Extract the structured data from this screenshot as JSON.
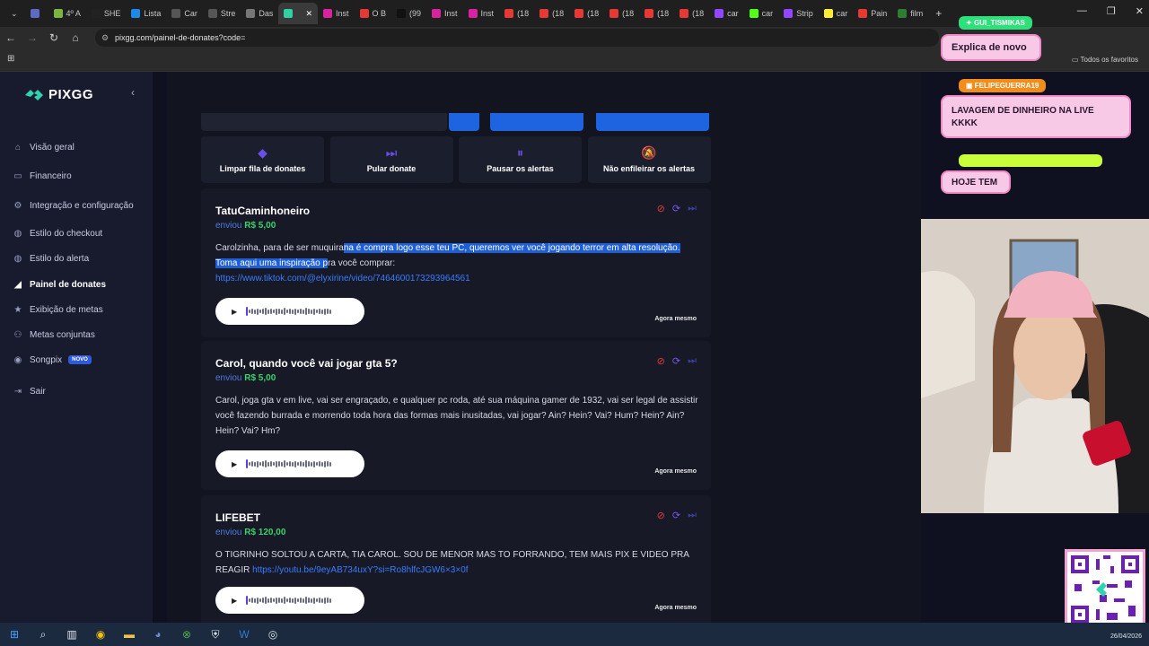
{
  "browser": {
    "tabs": [
      {
        "label": "",
        "color": "#5c6bc0"
      },
      {
        "label": "4º A",
        "color": "#7cb342"
      },
      {
        "label": "SHE",
        "color": "#222222"
      },
      {
        "label": "Lista",
        "color": "#1e88e5"
      },
      {
        "label": "Car",
        "color": "#555555"
      },
      {
        "label": "Stre",
        "color": "#555555"
      },
      {
        "label": "Das",
        "color": "#777777"
      },
      {
        "label": "",
        "color": "#30d0a0",
        "active": true
      },
      {
        "label": "Inst",
        "color": "#d6249f"
      },
      {
        "label": "O B",
        "color": "#e53935"
      },
      {
        "label": "(99",
        "color": "#111111"
      },
      {
        "label": "Inst",
        "color": "#d6249f"
      },
      {
        "label": "Inst",
        "color": "#d6249f"
      },
      {
        "label": "(18",
        "color": "#e53935"
      },
      {
        "label": "(18",
        "color": "#e53935"
      },
      {
        "label": "(18",
        "color": "#e53935"
      },
      {
        "label": "(18",
        "color": "#e53935"
      },
      {
        "label": "(18",
        "color": "#e53935"
      },
      {
        "label": "(18",
        "color": "#e53935"
      },
      {
        "label": "car",
        "color": "#9146ff"
      },
      {
        "label": "car",
        "color": "#53fc18"
      },
      {
        "label": "Strip",
        "color": "#9146ff"
      },
      {
        "label": "car",
        "color": "#ffeb3b"
      },
      {
        "label": "Pain",
        "color": "#e53935"
      },
      {
        "label": "film",
        "color": "#2e7d32"
      }
    ],
    "url": "pixgg.com/painel-de-donates?code=",
    "bookmarks_label": "Todos os favoritos"
  },
  "sidebar": {
    "logo": "PIXGG",
    "items": [
      {
        "label": "Visão geral",
        "icon": "home-icon",
        "glyph": "⌂"
      },
      {
        "label": "Financeiro",
        "icon": "wallet-icon",
        "glyph": "▭"
      },
      {
        "label": "Integração e configuração",
        "icon": "plug-icon",
        "glyph": "⚙"
      },
      {
        "label": "Estilo do checkout",
        "icon": "palette-icon",
        "glyph": "◍"
      },
      {
        "label": "Estilo do alerta",
        "icon": "palette-icon",
        "glyph": "◍"
      },
      {
        "label": "Painel de donates",
        "icon": "dashboard-icon",
        "glyph": "◢",
        "active": true
      },
      {
        "label": "Exibição de metas",
        "icon": "star-icon",
        "glyph": "★"
      },
      {
        "label": "Metas conjuntas",
        "icon": "users-icon",
        "glyph": "⚇"
      },
      {
        "label": "Songpix",
        "icon": "music-icon",
        "glyph": "◉",
        "badge": "NOVO"
      },
      {
        "label": "Sair",
        "icon": "logout-icon",
        "glyph": "⇥"
      }
    ]
  },
  "actions": [
    {
      "label": "Limpar fila de donates",
      "icon": "eraser-icon",
      "glyph": "◆"
    },
    {
      "label": "Pular donate",
      "icon": "skip-icon",
      "glyph": "⏭"
    },
    {
      "label": "Pausar os alertas",
      "icon": "pause-icon",
      "glyph": "⏸"
    },
    {
      "label": "Não enfileirar os alertas",
      "icon": "bell-off-icon",
      "glyph": "🔕"
    }
  ],
  "donations": [
    {
      "name": "TatuCaminhoneiro",
      "sent_prefix": "enviou",
      "amount": "R$ 5,00",
      "msg_pre": "Carolzinha, para de ser muquira",
      "msg_hl": "na é compra logo esse teu PC, queremos ver você jogando terror em alta resolução. Toma aqui uma inspiração p",
      "msg_post": "ra você comprar:",
      "link": "https://www.tiktok.com/@elyxirine/video/7464600173293964561",
      "time": "Agora mesmo"
    },
    {
      "name": "Carol, quando você vai jogar gta 5?",
      "sent_prefix": "enviou",
      "amount": "R$ 5,00",
      "msg_pre": "Carol, joga gta v em live, vai ser engraçado, e qualquer pc roda, até sua máquina gamer de 1932, vai ser legal de assistir você fazendo burrada e morrendo toda hora das formas mais inusitadas, vai jogar? Ain? Hein? Vai? Hum? Hein? Ain? Hein? Vai? Hm?",
      "msg_hl": "",
      "msg_post": "",
      "link": "",
      "time": "Agora mesmo"
    },
    {
      "name": "LIFEBET",
      "sent_prefix": "enviou",
      "amount": "R$ 120,00",
      "msg_pre": "O TIGRINHO SOLTOU A CARTA, TIA CAROL. SOU DE MENOR MAS TO FORRANDO, TEM MAIS PIX E VIDEO PRA REAGIR ",
      "msg_hl": "",
      "msg_post": "",
      "link": "https://youtu.be/9eyAB734uxY?si=Ro8hlfcJGW6×3×0f",
      "time": "Agora mesmo"
    }
  ],
  "overlay": {
    "chat1_user": "GUI_TISMIKAS",
    "chat1_text": "Explica de novo",
    "chat2_user": "FELIPEGUERRA19",
    "chat2_text": "LAVAGEM DE DINHEIRO NA LIVE KKKK",
    "chat3_text": "HOJE TEM",
    "accent_pink": "#f7c9e6",
    "accent_green": "#c8ff3a"
  },
  "taskbar": {
    "date": "26/04/2026"
  }
}
